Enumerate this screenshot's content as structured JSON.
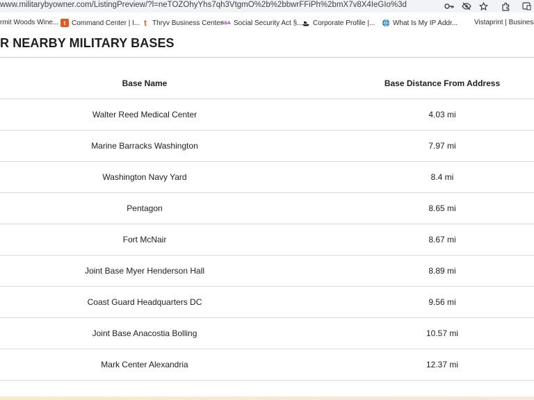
{
  "browser": {
    "url": "www.militarybyowner.com/ListingPreview/?l=neTOZOhyYhs7qh3VtgmO%2b%2bbwrFFiPh%2bmX7v8X4IeGIo%3d",
    "icons": [
      "key-icon",
      "eye-off-icon",
      "star-icon",
      "extensions-icon",
      "window-icon"
    ]
  },
  "bookmarks": [
    {
      "label": "rmit Woods Wine...",
      "icon": "none"
    },
    {
      "label": "Command Center | I...",
      "icon": "t-orange-square",
      "color": "#e8571d"
    },
    {
      "label": "Thryv Business Center",
      "icon": "t-orange",
      "color": "#e8571d"
    },
    {
      "label": "Social Security Act §...",
      "icon": "ssa",
      "color": "#5b2d8e"
    },
    {
      "label": "Corporate Profile |...",
      "icon": "ship",
      "color": "#1b1b1b"
    },
    {
      "label": "What Is My IP Addr...",
      "icon": "globe",
      "color": "#2a84c9"
    },
    {
      "label": "Vistaprint | Business...",
      "icon": "none"
    }
  ],
  "page": {
    "title": "R NEARBY MILITARY BASES"
  },
  "table": {
    "headers": [
      "Base Name",
      "Base Distance From Address"
    ],
    "rows": [
      [
        "Walter Reed Medical Center",
        "4.03 mi"
      ],
      [
        "Marine Barracks Washington",
        "7.97 mi"
      ],
      [
        "Washington Navy Yard",
        "8.4 mi"
      ],
      [
        "Pentagon",
        "8.65 mi"
      ],
      [
        "Fort McNair",
        "8.67 mi"
      ],
      [
        "Joint Base Myer Henderson Hall",
        "8.89 mi"
      ],
      [
        "Coast Guard Headquarters DC",
        "9.56 mi"
      ],
      [
        "Joint Base Anacostia Bolling",
        "10.57 mi"
      ],
      [
        "Mark Center Alexandria",
        "12.37 mi"
      ]
    ]
  }
}
